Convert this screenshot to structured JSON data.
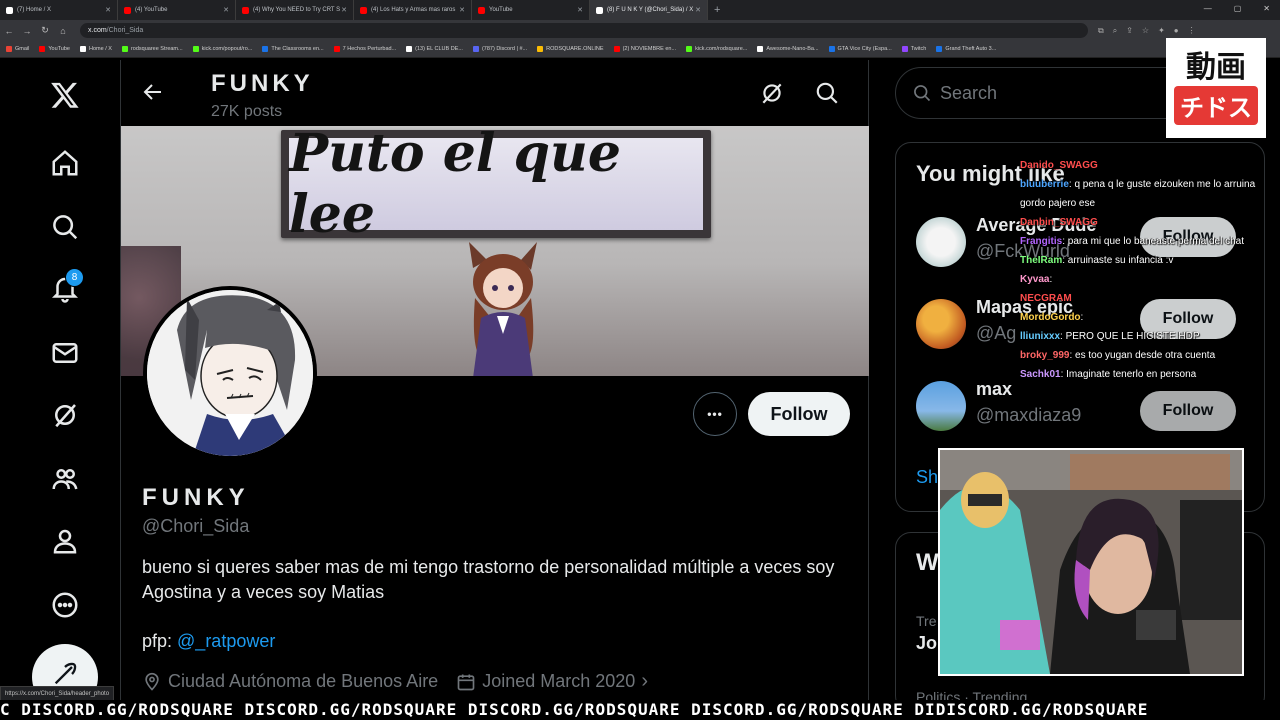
{
  "browser": {
    "tabs": [
      {
        "title": "(7) Home / X",
        "color": "#000"
      },
      {
        "title": "(4) YouTube",
        "color": "#ff0000"
      },
      {
        "title": "(4) Why You NEED to Try CRT S",
        "color": "#ff0000"
      },
      {
        "title": "(4) Los Hats y Armas mas raros",
        "color": "#ff0000"
      },
      {
        "title": "YouTube",
        "color": "#ff0000"
      },
      {
        "title": "(8) F U N K Y (@Chori_Sida) / X",
        "color": "#000"
      }
    ],
    "active_tab": 5,
    "url_host": "x.com",
    "url_path": "/Chori_Sida",
    "bookmarks": [
      "Gmail",
      "YouTube",
      "Home / X",
      "rodsquaree Stream...",
      "kick.com/popout/ro...",
      "The Classrooms en...",
      "7 Hechos Perturbad...",
      "(13) EL CLUB DE...",
      "(787) Discord | #...",
      "RODSQUARE.ONLINE",
      "(2) NOVIEMBRE en...",
      "kick.com/rodsquare...",
      "Awesome-Nano-Ba...",
      "GTA Vice City (Espa...",
      "Twitch",
      "Grand Theft Auto 3..."
    ],
    "status_url": "https://x.com/Chori_Sida/header_photo"
  },
  "nav": {
    "notification_count": "8"
  },
  "profile_header": {
    "name": "FUNKY",
    "posts": "27K posts"
  },
  "banner_text": "Puto el que lee",
  "profile": {
    "display_name": "FUNKY",
    "handle": "@Chori_Sida",
    "bio": "bueno si queres saber mas de mi tengo trastorno de personalidad múltiple a veces soy Agostina y a veces soy Matias",
    "pfp_label": "pfp: ",
    "pfp_link": "@_ratpower",
    "location": "Ciudad Autónoma de Buenos Aire",
    "joined": "Joined March 2020",
    "follow_label": "Follow",
    "more_label": "•••"
  },
  "sidebar": {
    "search_placeholder": "Search",
    "wtf_title": "You might like",
    "suggestions": [
      {
        "name": "Average Dude",
        "handle": "@FckWurld",
        "follow": "Follow"
      },
      {
        "name": "Mapas epic",
        "handle": "@Ag",
        "follow": "Follow"
      },
      {
        "name": "max",
        "handle": "@maxdiaza9",
        "follow": "Follow"
      }
    ],
    "show_more": "Sh",
    "whats_happening_title": "W",
    "trend_sub": "Tre",
    "trend_item": "Jo",
    "trend_foot": "Politics · Trending"
  },
  "overlay": {
    "logo_top": "動画",
    "logo_bottom": "チドス",
    "chat": [
      {
        "user": "Danido_SWAGG",
        "color": "#ff4d4d",
        "msg": ""
      },
      {
        "user": "bluuberrie",
        "color": "#4da6ff",
        "msg": ": q pena q le guste eizouken me lo arruina gordo pajero ese"
      },
      {
        "user": "Danbin_SWAGG",
        "color": "#ff4d4d",
        "msg": ""
      },
      {
        "user": "Frangitis",
        "color": "#b366ff",
        "msg": ": para mi que lo baneaste perma del chat"
      },
      {
        "user": "TheIRam",
        "color": "#7fff7f",
        "msg": ": arruinaste su infancia :v"
      },
      {
        "user": "Kyvaa",
        "color": "#ff99cc",
        "msg": ":"
      },
      {
        "user": "NECGRAM",
        "color": "#ff4d4d",
        "msg": ""
      },
      {
        "user": "MordoGordo",
        "color": "#ffd24d",
        "msg": ":"
      },
      {
        "user": "lliunixxx",
        "color": "#66ccff",
        "msg": ": PERO QUE LE HICISTE HDP"
      },
      {
        "user": "broky_999",
        "color": "#ff6666",
        "msg": ": es too yugan desde otra cuenta"
      },
      {
        "user": "Sachk01",
        "color": "#cc99ff",
        "msg": ": Imaginate tenerlo en persona"
      }
    ],
    "ticker": "C DISCORD.GG/RODSQUARE DISCORD.GG/RODSQUARE DISCORD.GG/RODSQUARE DISCORD.GG/RODSQUARE DIDISCORD.GG/RODSQUARE"
  }
}
